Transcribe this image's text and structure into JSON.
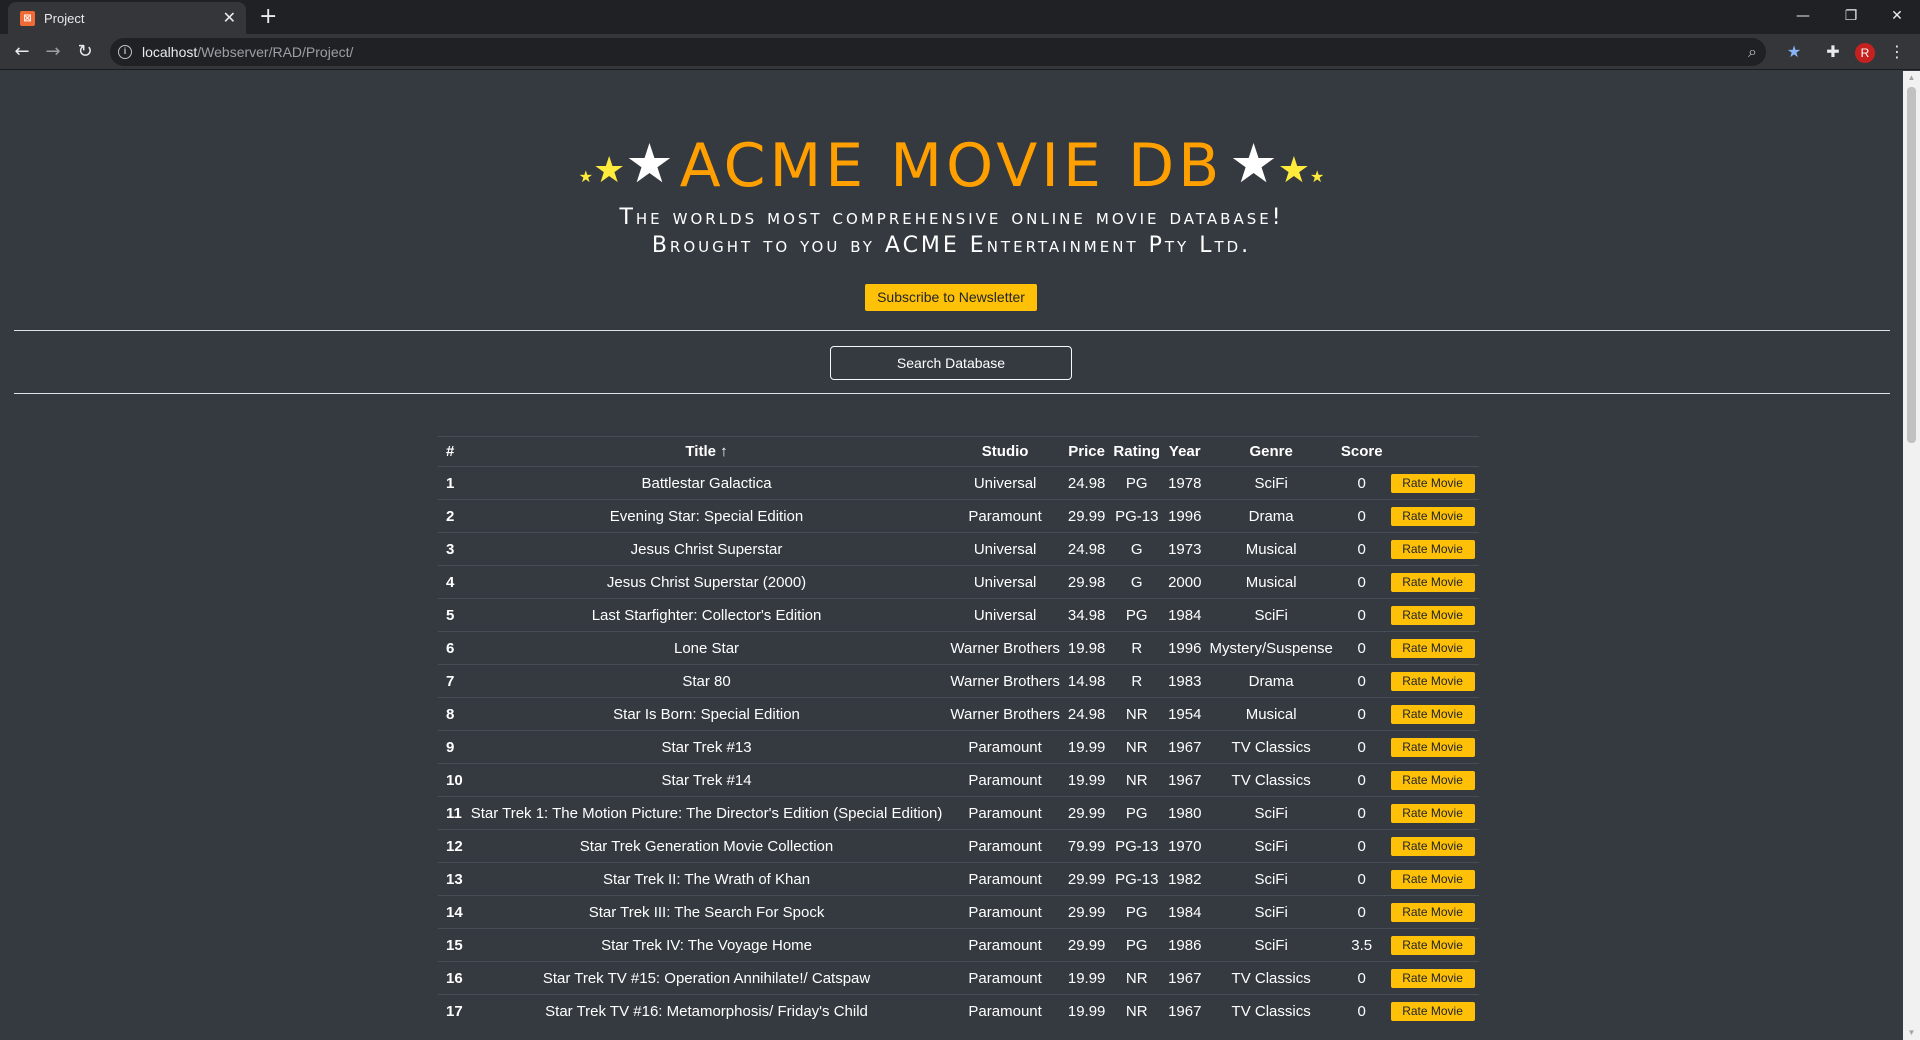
{
  "browser": {
    "tab_title": "Project",
    "tab_close": "✕",
    "new_tab": "+",
    "url_host": "localhost",
    "url_path": "/Webserver/RAD/Project/",
    "avatar_letter": "R",
    "icons": [
      "back-icon",
      "forward-icon",
      "reload-icon",
      "info-icon",
      "zoom-icon",
      "bookmark-star-icon",
      "extensions-icon",
      "menu-icon"
    ]
  },
  "header": {
    "brand": "ACME MOVIE DB",
    "tagline_1": "The worlds most comprehensive online movie database!",
    "tagline_2": "Brought to you by ACME Entertainment Pty Ltd.",
    "subscribe_label": "Subscribe to Newsletter",
    "search_label": "Search Database",
    "star_color": "#ffeb3b",
    "brand_color": "#ff9f00",
    "button_color": "#ffc107"
  },
  "table": {
    "headers": {
      "num": "#",
      "title": "Title ↑",
      "studio": "Studio",
      "price": "Price",
      "rating": "Rating",
      "year": "Year",
      "genre": "Genre",
      "score": "Score"
    },
    "rate_label": "Rate Movie",
    "rows": [
      {
        "num": "1",
        "title": "Battlestar Galactica",
        "studio": "Universal",
        "price": "24.98",
        "rating": "PG",
        "year": "1978",
        "genre": "SciFi",
        "score": "0"
      },
      {
        "num": "2",
        "title": "Evening Star: Special Edition",
        "studio": "Paramount",
        "price": "29.99",
        "rating": "PG-13",
        "year": "1996",
        "genre": "Drama",
        "score": "0"
      },
      {
        "num": "3",
        "title": "Jesus Christ Superstar",
        "studio": "Universal",
        "price": "24.98",
        "rating": "G",
        "year": "1973",
        "genre": "Musical",
        "score": "0"
      },
      {
        "num": "4",
        "title": "Jesus Christ Superstar (2000)",
        "studio": "Universal",
        "price": "29.98",
        "rating": "G",
        "year": "2000",
        "genre": "Musical",
        "score": "0"
      },
      {
        "num": "5",
        "title": "Last Starfighter: Collector's Edition",
        "studio": "Universal",
        "price": "34.98",
        "rating": "PG",
        "year": "1984",
        "genre": "SciFi",
        "score": "0"
      },
      {
        "num": "6",
        "title": "Lone Star",
        "studio": "Warner Brothers",
        "price": "19.98",
        "rating": "R",
        "year": "1996",
        "genre": "Mystery/Suspense",
        "score": "0"
      },
      {
        "num": "7",
        "title": "Star 80",
        "studio": "Warner Brothers",
        "price": "14.98",
        "rating": "R",
        "year": "1983",
        "genre": "Drama",
        "score": "0"
      },
      {
        "num": "8",
        "title": "Star Is Born: Special Edition",
        "studio": "Warner Brothers",
        "price": "24.98",
        "rating": "NR",
        "year": "1954",
        "genre": "Musical",
        "score": "0"
      },
      {
        "num": "9",
        "title": "Star Trek #13",
        "studio": "Paramount",
        "price": "19.99",
        "rating": "NR",
        "year": "1967",
        "genre": "TV Classics",
        "score": "0"
      },
      {
        "num": "10",
        "title": "Star Trek #14",
        "studio": "Paramount",
        "price": "19.99",
        "rating": "NR",
        "year": "1967",
        "genre": "TV Classics",
        "score": "0"
      },
      {
        "num": "11",
        "title": "Star Trek 1: The Motion Picture: The Director's Edition (Special Edition)",
        "studio": "Paramount",
        "price": "29.99",
        "rating": "PG",
        "year": "1980",
        "genre": "SciFi",
        "score": "0"
      },
      {
        "num": "12",
        "title": "Star Trek Generation Movie Collection",
        "studio": "Paramount",
        "price": "79.99",
        "rating": "PG-13",
        "year": "1970",
        "genre": "SciFi",
        "score": "0"
      },
      {
        "num": "13",
        "title": "Star Trek II: The Wrath of Khan",
        "studio": "Paramount",
        "price": "29.99",
        "rating": "PG-13",
        "year": "1982",
        "genre": "SciFi",
        "score": "0"
      },
      {
        "num": "14",
        "title": "Star Trek III: The Search For Spock",
        "studio": "Paramount",
        "price": "29.99",
        "rating": "PG",
        "year": "1984",
        "genre": "SciFi",
        "score": "0"
      },
      {
        "num": "15",
        "title": "Star Trek IV: The Voyage Home",
        "studio": "Paramount",
        "price": "29.99",
        "rating": "PG",
        "year": "1986",
        "genre": "SciFi",
        "score": "3.5"
      },
      {
        "num": "16",
        "title": "Star Trek TV #15: Operation Annihilate!/ Catspaw",
        "studio": "Paramount",
        "price": "19.99",
        "rating": "NR",
        "year": "1967",
        "genre": "TV Classics",
        "score": "0"
      },
      {
        "num": "17",
        "title": "Star Trek TV #16: Metamorphosis/ Friday's Child",
        "studio": "Paramount",
        "price": "19.99",
        "rating": "NR",
        "year": "1967",
        "genre": "TV Classics",
        "score": "0"
      }
    ]
  }
}
